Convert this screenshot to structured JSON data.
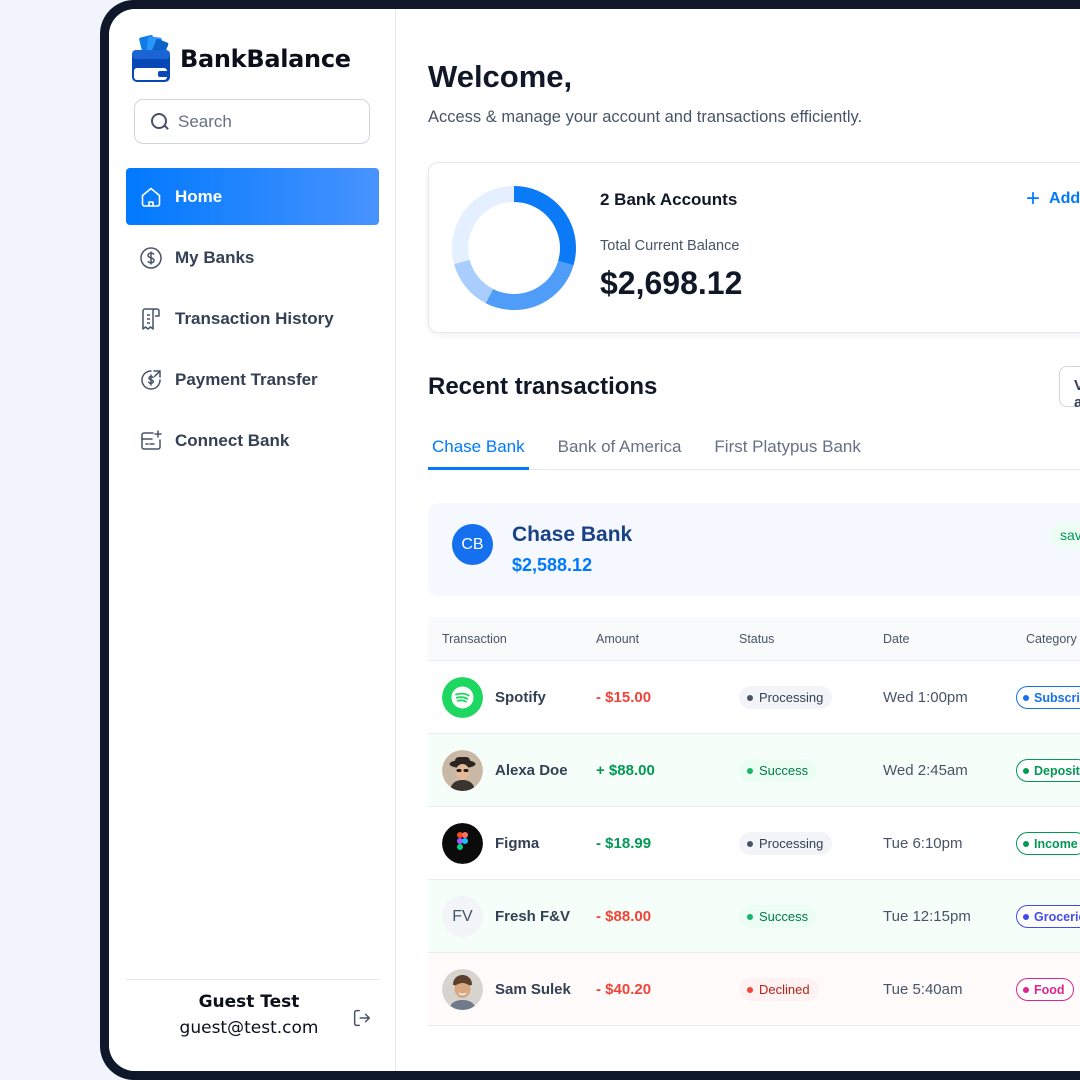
{
  "brand": {
    "name": "BankBalance"
  },
  "search": {
    "placeholder": "Search"
  },
  "nav": [
    {
      "label": "Home",
      "icon": "home-icon",
      "active": true
    },
    {
      "label": "My Banks",
      "icon": "dollar-circle-icon"
    },
    {
      "label": "Transaction History",
      "icon": "receipt-icon"
    },
    {
      "label": "Payment Transfer",
      "icon": "money-send-icon"
    },
    {
      "label": "Connect Bank",
      "icon": "connect-bank-icon"
    }
  ],
  "user": {
    "name": "Guest Test",
    "email": "guest@test.com"
  },
  "header": {
    "title": "Welcome,",
    "subtitle": "Access & manage your account and transactions efficiently."
  },
  "balance": {
    "accounts_label": "2 Bank Accounts",
    "total_label": "Total Current Balance",
    "total_value": "$2,698.12",
    "add_label": "Add",
    "chart_colors": [
      "#0747b6",
      "#2265d8",
      "#2f91fa"
    ]
  },
  "recent": {
    "title": "Recent transactions",
    "view_all": "View all",
    "tabs": [
      "Chase Bank",
      "Bank of America",
      "First Platypus Bank"
    ],
    "active_tab": 0
  },
  "bank_card": {
    "initials": "CB",
    "name": "Chase Bank",
    "balance": "$2,588.12",
    "type": "savings"
  },
  "table": {
    "headers": [
      "Transaction",
      "Amount",
      "Status",
      "Date",
      "Category"
    ],
    "rows": [
      {
        "name": "Spotify",
        "icon": "spotify-icon",
        "amount": "- $15.00",
        "amount_type": "neg",
        "status": "Processing",
        "date": "Wed 1:00pm",
        "category": "Subscriptions",
        "cat_color": "#1570ef"
      },
      {
        "name": "Alexa Doe",
        "icon": "avatar-alexa",
        "amount": "+ $88.00",
        "amount_type": "pos",
        "status": "Success",
        "date": "Wed 2:45am",
        "category": "Deposit",
        "cat_color": "#039855"
      },
      {
        "name": "Figma",
        "icon": "figma-icon",
        "amount": "- $18.99",
        "amount_type": "pos",
        "status": "Processing",
        "date": "Tue 6:10pm",
        "category": "Income",
        "cat_color": "#039855"
      },
      {
        "name": "Fresh F&V",
        "icon": "initials-fv",
        "initials": "FV",
        "amount": "- $88.00",
        "amount_type": "neg",
        "status": "Success",
        "date": "Tue 12:15pm",
        "category": "Groceries",
        "cat_color": "#444ce7"
      },
      {
        "name": "Sam Sulek",
        "icon": "avatar-sam",
        "amount": "- $40.20",
        "amount_type": "neg",
        "status": "Declined",
        "date": "Tue 5:40am",
        "category": "Food",
        "cat_color": "#dd2590"
      }
    ]
  }
}
